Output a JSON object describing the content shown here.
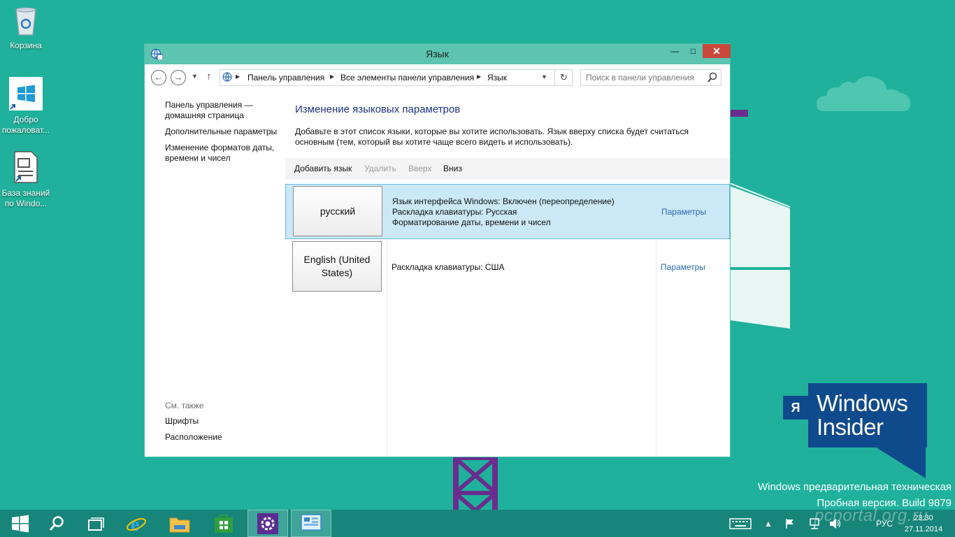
{
  "desktop": {
    "icons": [
      {
        "label": "Корзина"
      },
      {
        "label": "Добро пожаловат..."
      },
      {
        "label": "База знаний по Windo..."
      }
    ],
    "insider_badge": {
      "prefix": "Я",
      "line1": "Windows",
      "line2": "Insider"
    },
    "build_info": {
      "line1": "Windows предварительная техническая",
      "line2": "Пробная версия. Build 9879"
    },
    "watermark": "pcportal.org.ru"
  },
  "window": {
    "title": "Язык",
    "controls": {
      "minimize": "—",
      "maximize": "□",
      "close": "✕"
    },
    "breadcrumb": [
      "Панель управления",
      "Все элементы панели управления",
      "Язык"
    ],
    "search_placeholder": "Поиск в панели управления",
    "sidebar": {
      "links": [
        "Панель управления — домашняя страница",
        "Дополнительные параметры",
        "Изменение форматов даты, времени и чисел"
      ],
      "see_also_title": "См. также",
      "see_also_links": [
        "Шрифты",
        "Расположение"
      ]
    },
    "main": {
      "title": "Изменение языковых параметров",
      "description": "Добавьте в этот список языки, которые вы хотите использовать. Язык вверху списка будет считаться основным (тем, который вы хотите чаще всего видеть и использовать).",
      "toolbar": {
        "add": "Добавить язык",
        "remove": "Удалить",
        "up": "Вверх",
        "down": "Вниз"
      },
      "languages": [
        {
          "name": "русский",
          "details": [
            "Язык интерфейса Windows: Включен (переопределение)",
            "Раскладка клавиатуры: Русская",
            "Форматирование даты, времени и чисел"
          ],
          "options": "Параметры",
          "selected": true
        },
        {
          "name": "English (United States)",
          "details": [
            "Раскладка клавиатуры: США"
          ],
          "options": "Параметры",
          "selected": false
        }
      ]
    }
  },
  "taskbar": {
    "items": [
      "start-icon",
      "search-icon",
      "task-view-icon",
      "internet-explorer-icon",
      "file-explorer-icon",
      "store-icon",
      "settings-icon",
      "control-panel-icon"
    ],
    "tray": {
      "language": "РУС"
    },
    "clock": {
      "time": "23:30",
      "date": "27.11.2014"
    }
  },
  "colors": {
    "desktop": "#1fb19b",
    "titlebar": "#5cc4b0",
    "close": "#c9483b",
    "selection": "#cbe8f6",
    "link": "#2a6bb8",
    "heading": "#1e3287",
    "insider": "#0f4a8c"
  }
}
